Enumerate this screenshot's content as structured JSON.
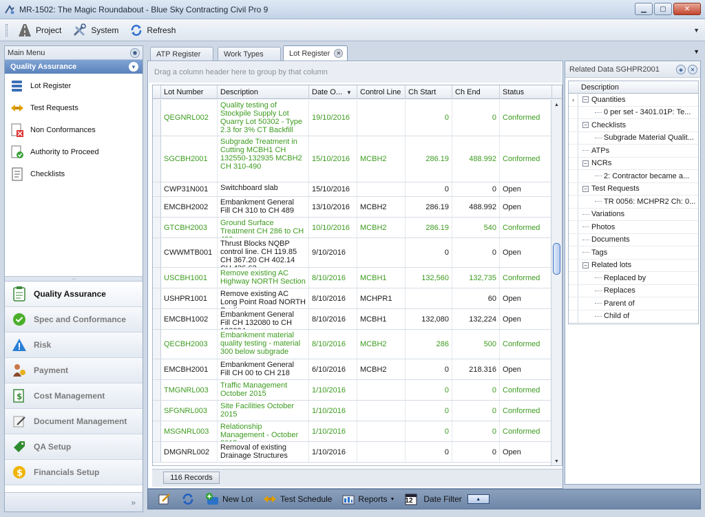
{
  "window": {
    "title": "MR-1502: The Magic Roundabout - Blue Sky Contracting Civil Pro 9"
  },
  "toolbar": {
    "project": "Project",
    "system": "System",
    "refresh": "Refresh"
  },
  "left_panel": {
    "header": "Main Menu",
    "group": "Quality Assurance",
    "items": [
      {
        "label": "Lot Register",
        "icon": "lot-register-icon"
      },
      {
        "label": "Test Requests",
        "icon": "test-requests-icon"
      },
      {
        "label": "Non Conformances",
        "icon": "non-conformances-icon"
      },
      {
        "label": "Authority to Proceed",
        "icon": "authority-icon"
      },
      {
        "label": "Checklists",
        "icon": "checklist-icon"
      }
    ],
    "nav": [
      {
        "label": "Quality Assurance",
        "active": true
      },
      {
        "label": "Spec and Conformance",
        "active": false
      },
      {
        "label": "Risk",
        "active": false
      },
      {
        "label": "Payment",
        "active": false
      },
      {
        "label": "Cost Management",
        "active": false
      },
      {
        "label": "Document Management",
        "active": false
      },
      {
        "label": "QA Setup",
        "active": false
      },
      {
        "label": "Financials Setup",
        "active": false
      }
    ],
    "more": "»"
  },
  "tabs": [
    {
      "label": "ATP Register",
      "active": false
    },
    {
      "label": "Work Types",
      "active": false
    },
    {
      "label": "Lot Register",
      "active": true
    }
  ],
  "grid": {
    "group_hint": "Drag a column header here to group by that column",
    "columns": [
      "Lot Number",
      "Description",
      "Date O...",
      "Control Line",
      "Ch Start",
      "Ch End",
      "Status"
    ],
    "rows": [
      {
        "lot": "QEGNRL002",
        "desc": "Quality testing of Stockpile Supply Lot Quarry Lot 50302 - Type 2.3 for 3% CT Backfill",
        "date": "19/10/2016",
        "line": "",
        "start": "0",
        "end": "0",
        "status": "Conformed",
        "conformed": true,
        "h": 53
      },
      {
        "lot": "SGCBH2001",
        "desc": "Subgrade Treatment in Cutting MCBH1 CH 132550-132935 MCBH2 CH 310-490",
        "date": "15/10/2016",
        "line": "MCBH2",
        "start": "286.19",
        "end": "488.992",
        "status": "Conformed",
        "conformed": true,
        "h": 67
      },
      {
        "lot": "CWP31N001",
        "desc": "Switchboard slab",
        "date": "15/10/2016",
        "line": "",
        "start": "0",
        "end": "0",
        "status": "Open",
        "conformed": false,
        "h": 21
      },
      {
        "lot": "EMCBH2002",
        "desc": "Embankment General Fill CH 310 to CH 489",
        "date": "13/10/2016",
        "line": "MCBH2",
        "start": "286.19",
        "end": "488.992",
        "status": "Open",
        "conformed": false,
        "h": 30
      },
      {
        "lot": "GTCBH2003",
        "desc": "Ground Surface Treatment CH 286 to CH 490",
        "date": "10/10/2016",
        "line": "MCBH2",
        "start": "286.19",
        "end": "540",
        "status": "Conformed",
        "conformed": true,
        "h": 30
      },
      {
        "lot": "CWWMTB001",
        "desc": "Thrust Blocks NQBP control line. CH 119.85 CH 367.20 CH 402.14 CH 436.62",
        "date": "9/10/2016",
        "line": "",
        "start": "0",
        "end": "0",
        "status": "Open",
        "conformed": false,
        "h": 43
      },
      {
        "lot": "USCBH1001",
        "desc": "Remove existing AC Highway NORTH Section",
        "date": "8/10/2016",
        "line": "MCBH1",
        "start": "132,560",
        "end": "132,735",
        "status": "Conformed",
        "conformed": true,
        "h": 30
      },
      {
        "lot": "USHPR1001",
        "desc": "Remove existing AC Long Point Road NORTH Section",
        "date": "8/10/2016",
        "line": "MCHPR1",
        "start": "",
        "end": "60",
        "status": "Open",
        "conformed": false,
        "h": 30
      },
      {
        "lot": "EMCBH1002",
        "desc": "Embankment General Fill CH 132080 to CH 132224",
        "date": "8/10/2016",
        "line": "MCBH1",
        "start": "132,080",
        "end": "132,224",
        "status": "Open",
        "conformed": false,
        "h": 30
      },
      {
        "lot": "QECBH2003",
        "desc": "Embankment material quality testing - material 300 below subgrade",
        "date": "8/10/2016",
        "line": "MCBH2",
        "start": "286",
        "end": "500",
        "status": "Conformed",
        "conformed": true,
        "h": 43
      },
      {
        "lot": "EMCBH2001",
        "desc": "Embankment General Fill CH 00 to CH 218",
        "date": "6/10/2016",
        "line": "MCBH2",
        "start": "0",
        "end": "218.316",
        "status": "Open",
        "conformed": false,
        "h": 30
      },
      {
        "lot": "TMGNRL003",
        "desc": "Traffic Management October 2015",
        "date": "1/10/2016",
        "line": "",
        "start": "0",
        "end": "0",
        "status": "Conformed",
        "conformed": true,
        "h": 30
      },
      {
        "lot": "SFGNRL003",
        "desc": "Site Facilities October 2015",
        "date": "1/10/2016",
        "line": "",
        "start": "0",
        "end": "0",
        "status": "Conformed",
        "conformed": true,
        "h": 30
      },
      {
        "lot": "MSGNRL003",
        "desc": "Relationship Management - October 2015",
        "date": "1/10/2016",
        "line": "",
        "start": "0",
        "end": "0",
        "status": "Conformed",
        "conformed": true,
        "h": 30
      },
      {
        "lot": "DMGNRL002",
        "desc": "Removal of existing Drainage Structures",
        "date": "1/10/2016",
        "line": "",
        "start": "0",
        "end": "0",
        "status": "Open",
        "conformed": false,
        "h": 30
      }
    ],
    "records": "116 Records"
  },
  "bottom_toolbar": {
    "new_lot": "New Lot",
    "test_schedule": "Test Schedule",
    "reports": "Reports",
    "date_filter": "Date Filter",
    "calendar_day": "12"
  },
  "related": {
    "title": "Related Data SGHPR2001",
    "column": "Description",
    "rows": [
      {
        "level": 0,
        "label": "Quantities",
        "exp": "−",
        "current": true
      },
      {
        "level": 1,
        "label": "0 per set - 3401.01P: Te..."
      },
      {
        "level": 0,
        "label": "Checklists",
        "exp": "−"
      },
      {
        "level": 1,
        "label": "Subgrade Material Qualit..."
      },
      {
        "level": 0,
        "label": "ATPs"
      },
      {
        "level": 0,
        "label": "NCRs",
        "exp": "−"
      },
      {
        "level": 1,
        "label": "2: Contractor became a..."
      },
      {
        "level": 0,
        "label": "Test Requests",
        "exp": "−"
      },
      {
        "level": 1,
        "label": "TR 0056: MCHPR2 Ch: 0..."
      },
      {
        "level": 0,
        "label": "Variations"
      },
      {
        "level": 0,
        "label": "Photos"
      },
      {
        "level": 0,
        "label": "Documents"
      },
      {
        "level": 0,
        "label": "Tags"
      },
      {
        "level": 0,
        "label": "Related lots",
        "exp": "−"
      },
      {
        "level": 1,
        "label": "Replaced by"
      },
      {
        "level": 1,
        "label": "Replaces"
      },
      {
        "level": 1,
        "label": "Parent of"
      },
      {
        "level": 1,
        "label": "Child of"
      }
    ]
  }
}
